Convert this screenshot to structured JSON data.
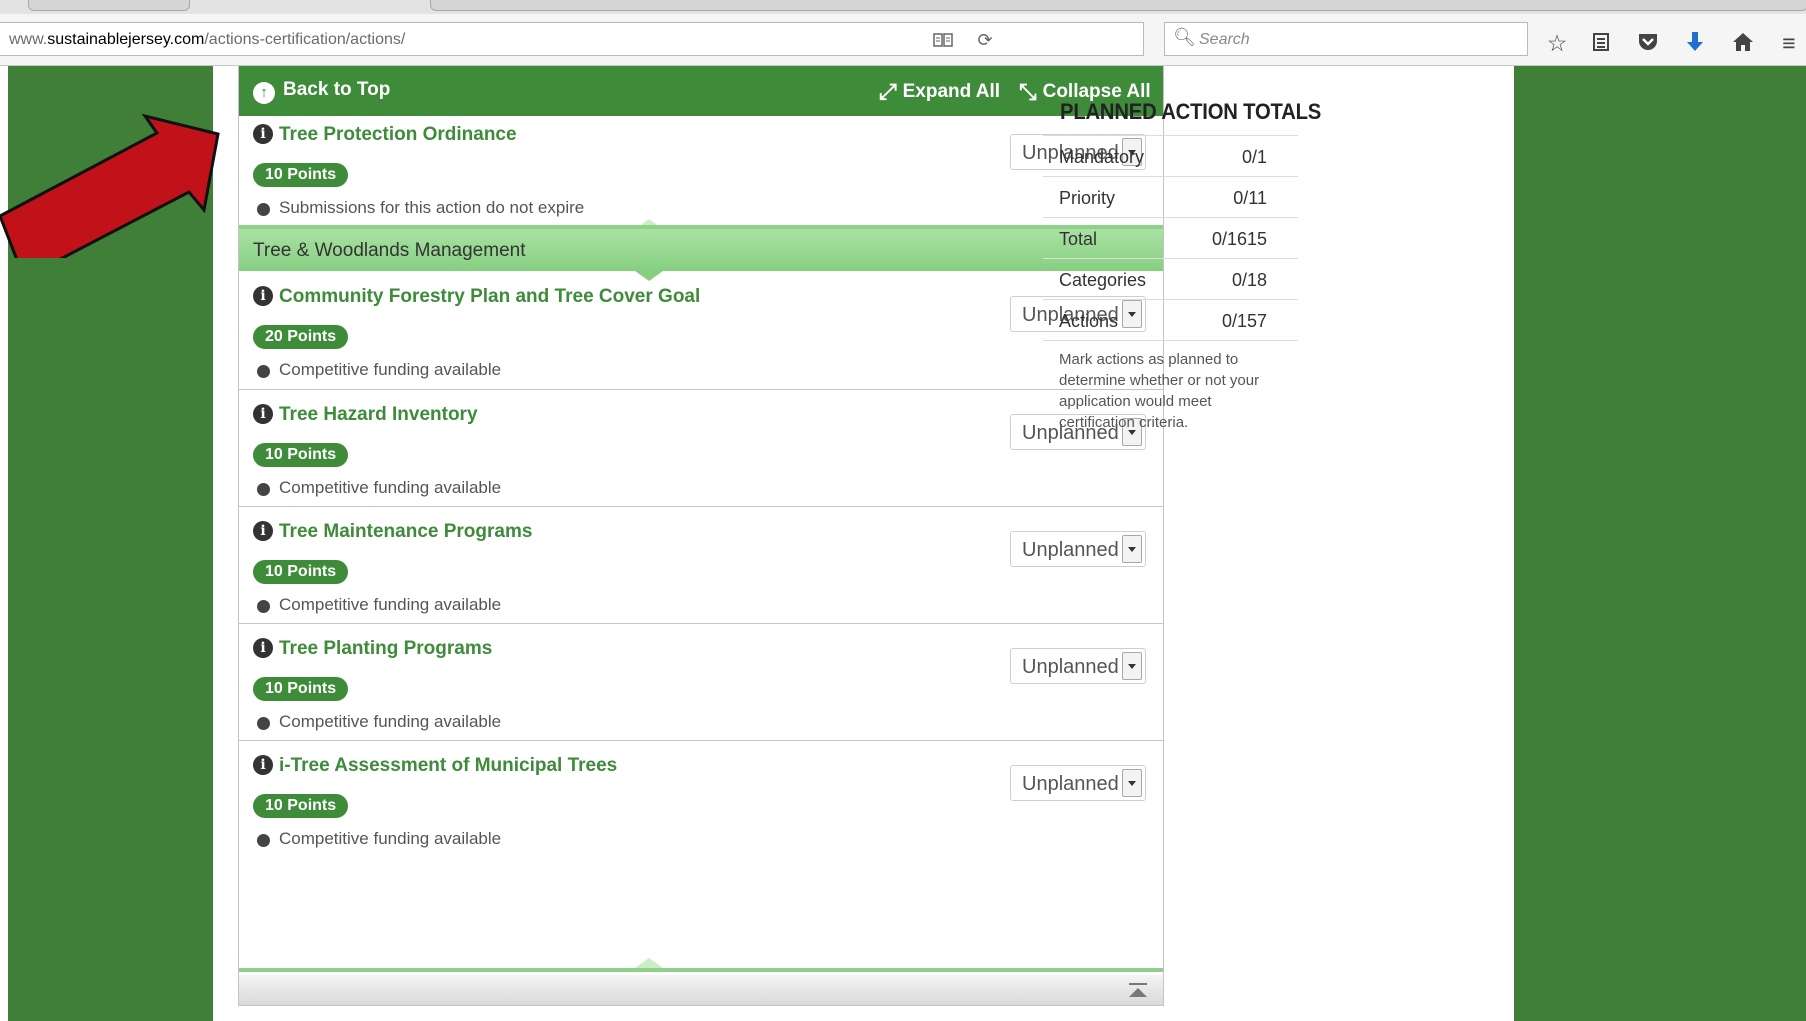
{
  "browser": {
    "url": {
      "prefix": "www.",
      "domain": "sustainablejersey.com",
      "path": "/actions-certification/actions/"
    },
    "search_placeholder": "Search"
  },
  "toolbar": {
    "back_to_top": "Back to Top",
    "expand_all": "Expand All",
    "collapse_all": "Collapse All"
  },
  "actions_top": [
    {
      "title": "Tree Protection Ordinance",
      "points": "10 Points",
      "note": "Submissions for this action do not expire",
      "status": "Unplanned"
    }
  ],
  "category": {
    "label": "Tree & Woodlands Management"
  },
  "actions": [
    {
      "title": "Community Forestry Plan and Tree Cover Goal",
      "points": "20 Points",
      "note": "Competitive funding available",
      "status": "Unplanned"
    },
    {
      "title": "Tree Hazard Inventory",
      "points": "10 Points",
      "note": "Competitive funding available",
      "status": "Unplanned"
    },
    {
      "title": "Tree Maintenance Programs",
      "points": "10 Points",
      "note": "Competitive funding available",
      "status": "Unplanned"
    },
    {
      "title": "Tree Planting Programs",
      "points": "10 Points",
      "note": "Competitive funding available",
      "status": "Unplanned"
    },
    {
      "title": "i-Tree Assessment of Municipal Trees",
      "points": "10 Points",
      "note": "Competitive funding available",
      "status": "Unplanned"
    }
  ],
  "totals": {
    "title": "PLANNED ACTION TOTALS",
    "rows": [
      {
        "label": "Mandatory",
        "value": "0/1"
      },
      {
        "label": "Priority",
        "value": "0/11"
      },
      {
        "label": "Total",
        "value": "0/1615"
      },
      {
        "label": "Categories",
        "value": "0/18"
      },
      {
        "label": "Actions",
        "value": "0/157"
      }
    ],
    "note": "Mark actions as planned to determine whether or not your application would meet certification criteria."
  },
  "colors": {
    "site_green": "#3e8b3a",
    "page_bg": "#3f7f38",
    "category_green": "#a9e2a3",
    "annotation_red": "#c1121a"
  }
}
